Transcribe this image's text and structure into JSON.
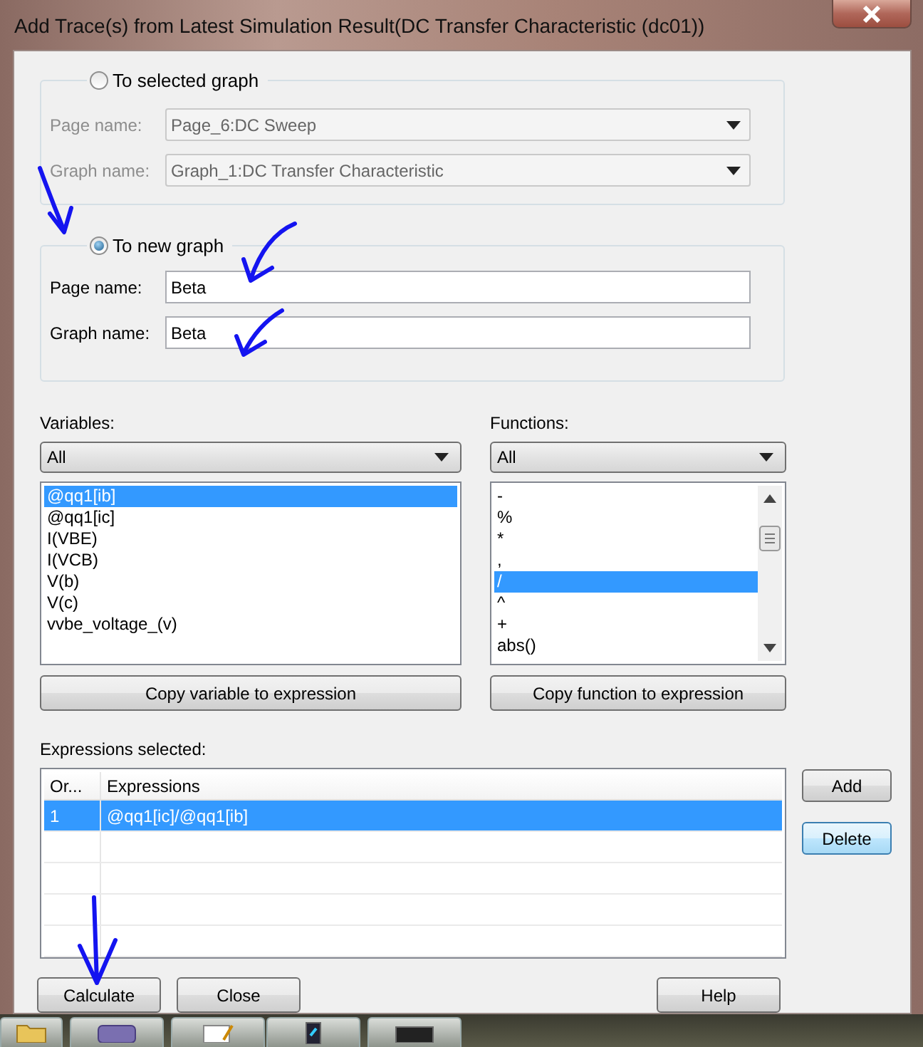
{
  "window": {
    "title": "Add Trace(s) from Latest Simulation Result(DC Transfer Characteristic (dc01))"
  },
  "target_options": [
    {
      "label": "To selected graph",
      "selected": false,
      "fields": [
        {
          "label": "Page name:",
          "value": "Page_6:DC Sweep",
          "kind": "dropdown"
        },
        {
          "label": "Graph name:",
          "value": "Graph_1:DC Transfer Characteristic",
          "kind": "dropdown"
        }
      ]
    },
    {
      "label": "To new graph",
      "selected": true,
      "fields": [
        {
          "label": "Page name:",
          "value": "Beta",
          "kind": "text"
        },
        {
          "label": "Graph name:",
          "value": "Beta",
          "kind": "text"
        }
      ]
    }
  ],
  "pickers": [
    {
      "label": "Variables:",
      "filter": "All",
      "scrollbar": false,
      "button": "Copy variable to expression",
      "items": [
        {
          "text": "@qq1[ib]",
          "selected": true
        },
        {
          "text": "@qq1[ic]",
          "selected": false
        },
        {
          "text": "I(VBE)",
          "selected": false
        },
        {
          "text": "I(VCB)",
          "selected": false
        },
        {
          "text": "V(b)",
          "selected": false
        },
        {
          "text": "V(c)",
          "selected": false
        },
        {
          "text": "vvbe_voltage_(v)",
          "selected": false
        }
      ]
    },
    {
      "label": "Functions:",
      "filter": "All",
      "scrollbar": true,
      "button": "Copy function to expression",
      "items": [
        {
          "text": "-",
          "selected": false
        },
        {
          "text": "%",
          "selected": false
        },
        {
          "text": "*",
          "selected": false
        },
        {
          "text": ",",
          "selected": false
        },
        {
          "text": "/",
          "selected": true
        },
        {
          "text": "^",
          "selected": false
        },
        {
          "text": "+",
          "selected": false
        },
        {
          "text": "abs()",
          "selected": false
        }
      ]
    }
  ],
  "expressions": {
    "label": "Expressions selected:",
    "columns": [
      "Or...",
      "Expressions"
    ],
    "rows": [
      {
        "cells": [
          "1",
          "@qq1[ic]/@qq1[ib]"
        ],
        "selected": true
      }
    ],
    "buttons": [
      {
        "label": "Add",
        "focused": false
      },
      {
        "label": "Delete",
        "focused": true
      }
    ]
  },
  "footer": {
    "left_buttons": [
      "Calculate",
      "Close"
    ],
    "right_buttons": [
      "Help"
    ]
  }
}
